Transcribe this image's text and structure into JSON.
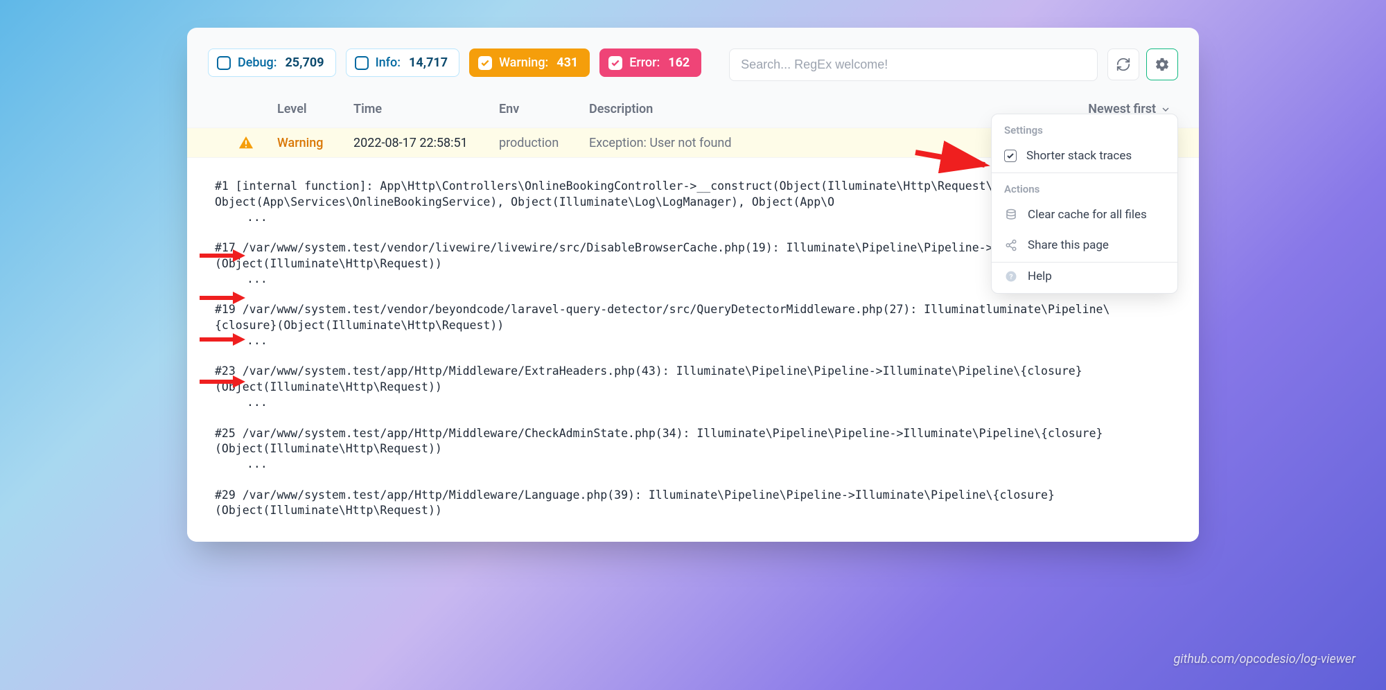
{
  "filters": {
    "debug": {
      "label": "Debug:",
      "count": "25,709",
      "checked": false
    },
    "info": {
      "label": "Info:",
      "count": "14,717",
      "checked": false
    },
    "warning": {
      "label": "Warning:",
      "count": "431",
      "checked": true
    },
    "error": {
      "label": "Error:",
      "count": "162",
      "checked": true
    }
  },
  "search": {
    "placeholder": "Search... RegEx welcome!"
  },
  "columns": {
    "level": "Level",
    "time": "Time",
    "env": "Env",
    "description": "Description",
    "sort": "Newest first"
  },
  "entry": {
    "level": "Warning",
    "time": "2022-08-17 22:58:51",
    "env": "production",
    "description": "Exception: User not found"
  },
  "stack": {
    "l1": "#1 [internal function]: App\\Http\\Controllers\\OnlineBookingController->__construct(Object(Illuminate\\Http\\Request\\ClientLoginService), Object(App\\Services\\OnlineBookingService), Object(Illuminate\\Log\\LogManager), Object(App\\O",
    "e1": "...",
    "l2": "#17 /var/www/system.test/vendor/livewire/livewire/src/DisableBrowserCache.php(19): Illuminate\\Pipeline\\Pipeline->losure}(Object(Illuminate\\Http\\Request))",
    "e2": "...",
    "l3": "#19 /var/www/system.test/vendor/beyondcode/laravel-query-detector/src/QueryDetectorMiddleware.php(27): Illuminatluminate\\Pipeline\\{closure}(Object(Illuminate\\Http\\Request))",
    "e3": "...",
    "l4": "#23 /var/www/system.test/app/Http/Middleware/ExtraHeaders.php(43): Illuminate\\Pipeline\\Pipeline->Illuminate\\Pipeline\\{closure}(Object(Illuminate\\Http\\Request))",
    "e4": "...",
    "l5": "#25 /var/www/system.test/app/Http/Middleware/CheckAdminState.php(34): Illuminate\\Pipeline\\Pipeline->Illuminate\\Pipeline\\{closure}(Object(Illuminate\\Http\\Request))",
    "e5": "...",
    "l6": "#29 /var/www/system.test/app/Http/Middleware/Language.php(39): Illuminate\\Pipeline\\Pipeline->Illuminate\\Pipeline\\{closure}(Object(Illuminate\\Http\\Request))"
  },
  "dropdown": {
    "settings_hdr": "Settings",
    "shorter": "Shorter stack traces",
    "actions_hdr": "Actions",
    "clear_cache": "Clear cache for all files",
    "share": "Share this page",
    "help": "Help"
  },
  "credit": "github.com/opcodesio/log-viewer"
}
